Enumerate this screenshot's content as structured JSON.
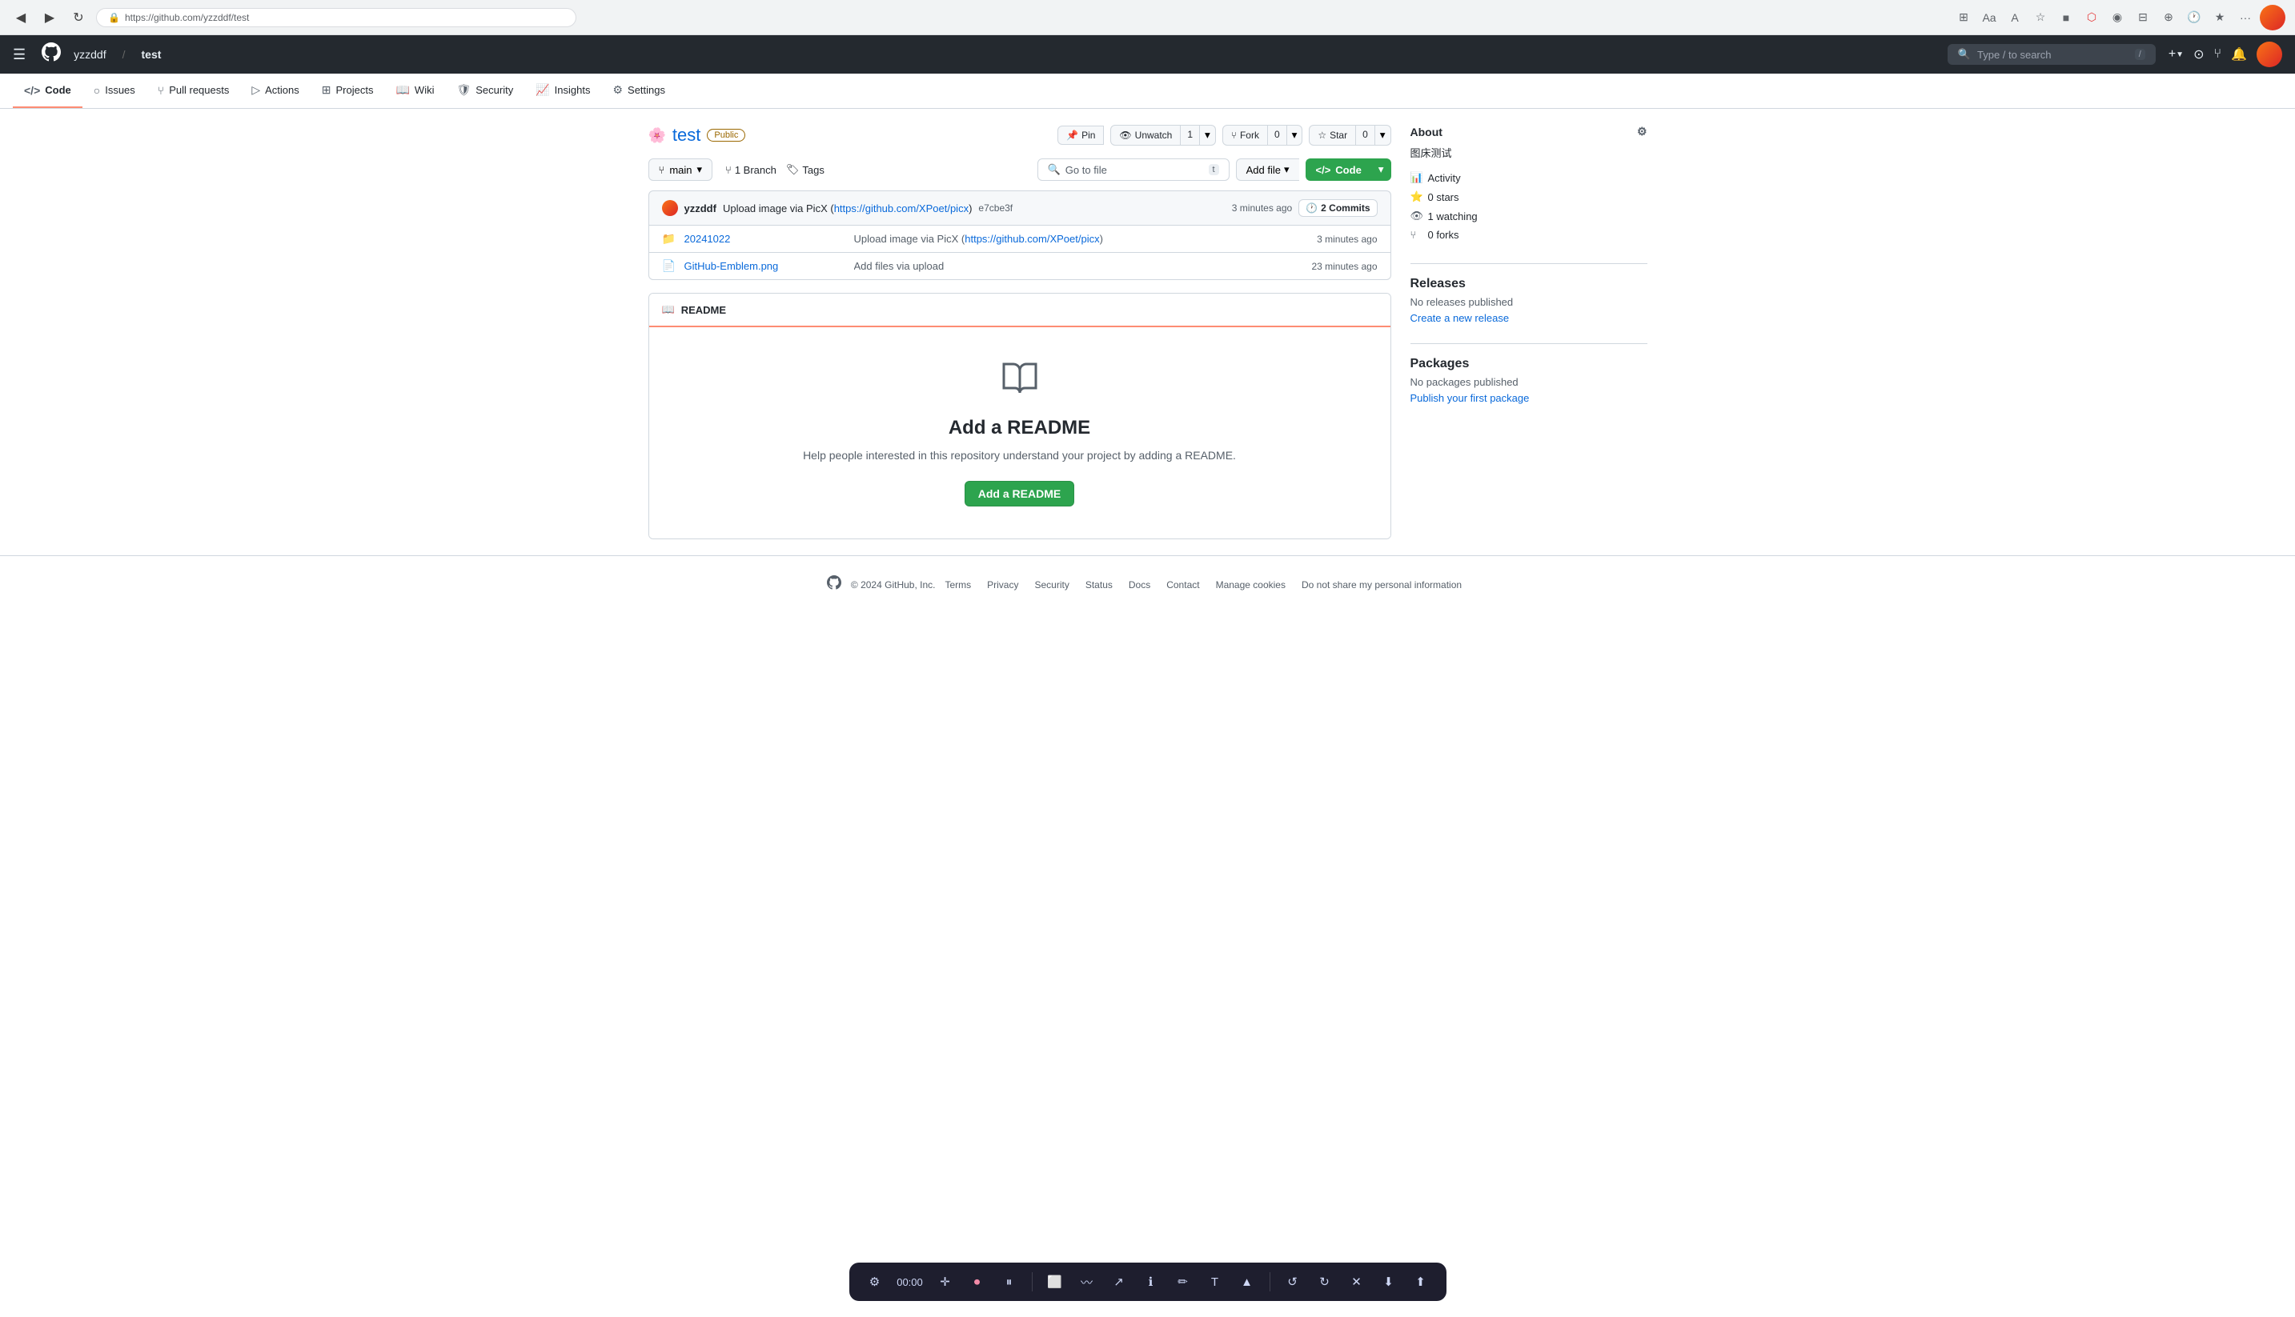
{
  "browser": {
    "url": "https://github.com/yzzddf/test",
    "back_icon": "◀",
    "forward_icon": "▶",
    "refresh_icon": "↻"
  },
  "github_header": {
    "logo": "🐙",
    "user": "yzzddf",
    "slash": "/",
    "repo": "test",
    "search_placeholder": "Type / to search",
    "search_shortcut": "/",
    "plus_icon": "+",
    "bell_icon": "🔔"
  },
  "repo_nav": {
    "items": [
      {
        "id": "code",
        "label": "Code",
        "icon": "</>",
        "active": true
      },
      {
        "id": "issues",
        "label": "Issues",
        "icon": "○"
      },
      {
        "id": "pull-requests",
        "label": "Pull requests",
        "icon": "⑂"
      },
      {
        "id": "actions",
        "label": "Actions",
        "icon": "▷"
      },
      {
        "id": "projects",
        "label": "Projects",
        "icon": "⊞"
      },
      {
        "id": "wiki",
        "label": "Wiki",
        "icon": "📖"
      },
      {
        "id": "security",
        "label": "Security",
        "icon": "🛡"
      },
      {
        "id": "insights",
        "label": "Insights",
        "icon": "📈"
      },
      {
        "id": "settings",
        "label": "Settings",
        "icon": "⚙"
      }
    ]
  },
  "repo": {
    "name": "test",
    "visibility": "Public",
    "pin_label": "Pin",
    "unwatch_label": "Unwatch",
    "unwatch_count": "1",
    "fork_label": "Fork",
    "fork_count": "0",
    "star_label": "Star",
    "star_count": "0"
  },
  "file_browser": {
    "branch": "main",
    "branch_label": "1 Branch",
    "tags_label": "Tags",
    "go_to_file_placeholder": "Go to file",
    "go_to_file_shortcut": "t",
    "add_file_label": "Add file",
    "code_label": "Code",
    "commit_hash": "e7cbe3f",
    "commit_time": "3 minutes ago",
    "commit_count": "2 Commits",
    "committer": "yzzddf",
    "commit_message": "Upload image via PicX",
    "commit_link_url": "https://github.com/XPoet/picx",
    "commit_link_text": "https://github.com/XPoet/picx"
  },
  "files": [
    {
      "type": "folder",
      "name": "20241022",
      "commit_msg": "Upload image via PicX (",
      "commit_link": "https://github.com/XPoet/picx",
      "commit_link_text": "https://github.com/XPoet/picx",
      "commit_msg_end": ")",
      "time": "3 minutes ago"
    },
    {
      "type": "file",
      "name": "GitHub-Emblem.png",
      "commit_msg": "Add files via upload",
      "commit_link": "",
      "time": "23 minutes ago"
    }
  ],
  "readme": {
    "header_label": "README",
    "icon": "📖",
    "title": "Add a README",
    "description": "Help people interested in this repository understand your project by adding a README.",
    "button_label": "Add a README"
  },
  "sidebar": {
    "about_title": "About",
    "settings_icon": "⚙",
    "description": "图床测试",
    "stats": [
      {
        "icon": "📊",
        "label": "Activity"
      },
      {
        "icon": "⭐",
        "label": "0 stars"
      },
      {
        "icon": "👁",
        "label": "1 watching"
      },
      {
        "icon": "⑂",
        "label": "0 forks"
      }
    ],
    "releases_title": "Releases",
    "no_releases": "No releases published",
    "create_release_label": "Create a new release",
    "packages_title": "Packages",
    "no_packages": "No packages published",
    "publish_package_label": "Publish your first package"
  },
  "footer": {
    "copyright": "© 2024 GitHub, Inc.",
    "links": [
      "Terms",
      "Privacy",
      "Security",
      "Status",
      "Docs",
      "Contact",
      "Manage cookies",
      "Do not share my personal information"
    ]
  },
  "bottom_toolbar": {
    "time": "00:00"
  }
}
